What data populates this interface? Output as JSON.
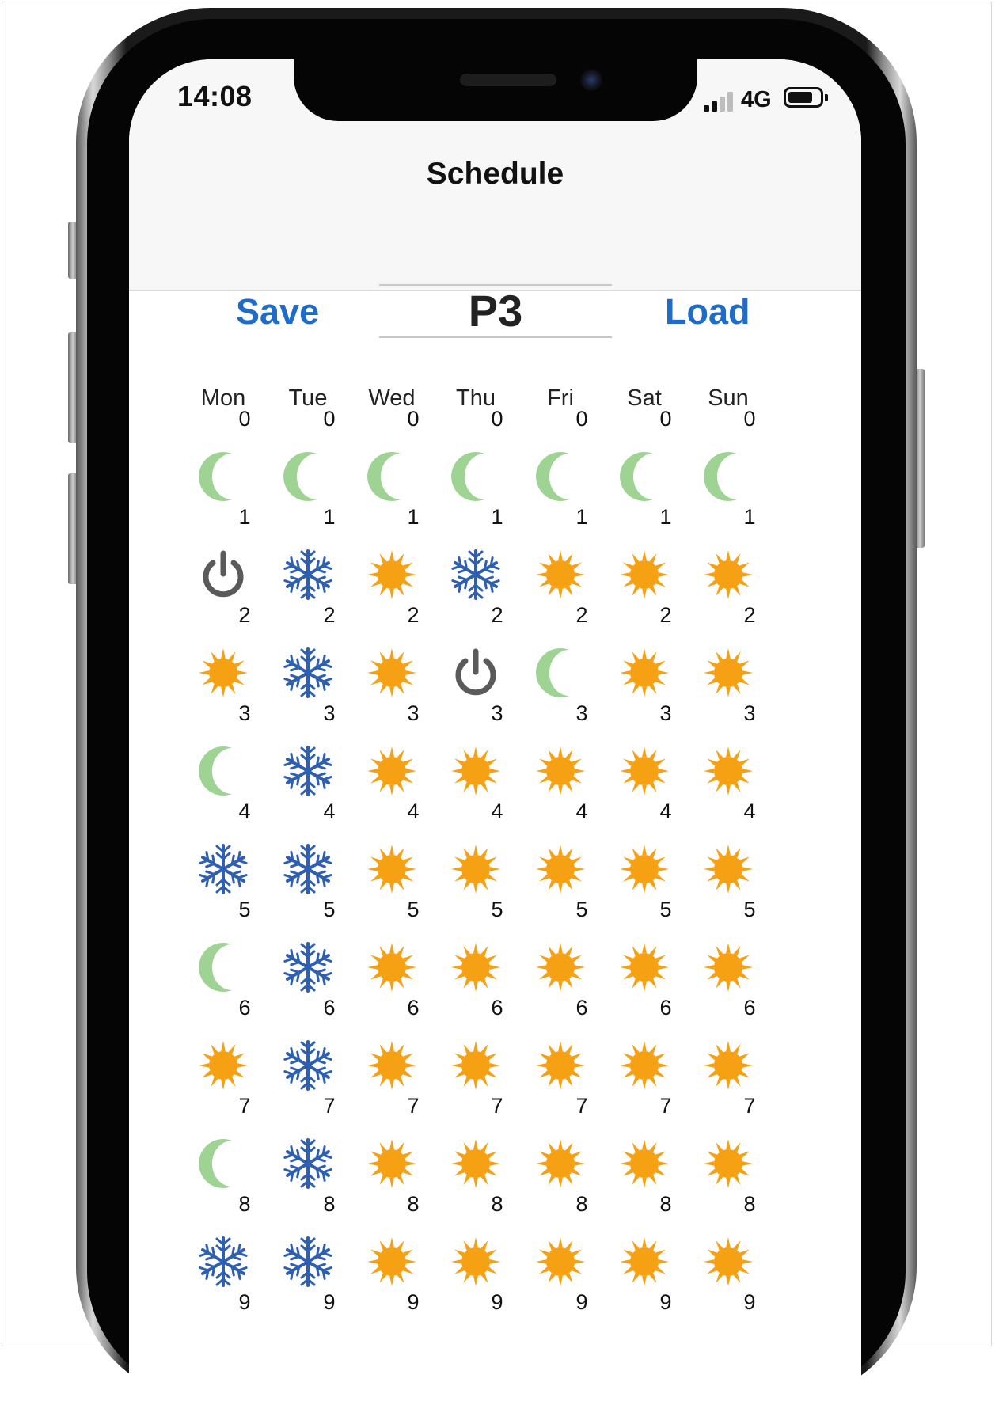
{
  "status_bar": {
    "time": "14:08",
    "network": "4G"
  },
  "header": {
    "title": "Schedule"
  },
  "toolbar": {
    "save_label": "Save",
    "load_label": "Load",
    "program": "P3"
  },
  "days": [
    "Mon",
    "Tue",
    "Wed",
    "Thu",
    "Fri",
    "Sat",
    "Sun"
  ],
  "colors": {
    "accent": "#1f6cc8",
    "moon": "#9fd393",
    "sun": "#f5a113",
    "snowflake": "#2f5fb0",
    "power": "#5a5a5a"
  },
  "icons": {
    "moon": "moon-icon",
    "sun": "sun-icon",
    "snow": "snowflake-icon",
    "off": "power-icon"
  },
  "hours": [
    0,
    1,
    2,
    3,
    4,
    5,
    6,
    7,
    8,
    9
  ],
  "schedule": [
    [
      "moon",
      "moon",
      "moon",
      "moon",
      "moon",
      "moon",
      "moon"
    ],
    [
      "off",
      "snow",
      "sun",
      "snow",
      "sun",
      "sun",
      "sun"
    ],
    [
      "sun",
      "snow",
      "sun",
      "off",
      "moon",
      "sun",
      "sun"
    ],
    [
      "moon",
      "snow",
      "sun",
      "sun",
      "sun",
      "sun",
      "sun"
    ],
    [
      "snow",
      "snow",
      "sun",
      "sun",
      "sun",
      "sun",
      "sun"
    ],
    [
      "moon",
      "snow",
      "sun",
      "sun",
      "sun",
      "sun",
      "sun"
    ],
    [
      "sun",
      "snow",
      "sun",
      "sun",
      "sun",
      "sun",
      "sun"
    ],
    [
      "moon",
      "snow",
      "sun",
      "sun",
      "sun",
      "sun",
      "sun"
    ],
    [
      "snow",
      "snow",
      "sun",
      "sun",
      "sun",
      "sun",
      "sun"
    ],
    [
      "",
      "",
      "",
      "",
      "",
      "",
      ""
    ]
  ]
}
